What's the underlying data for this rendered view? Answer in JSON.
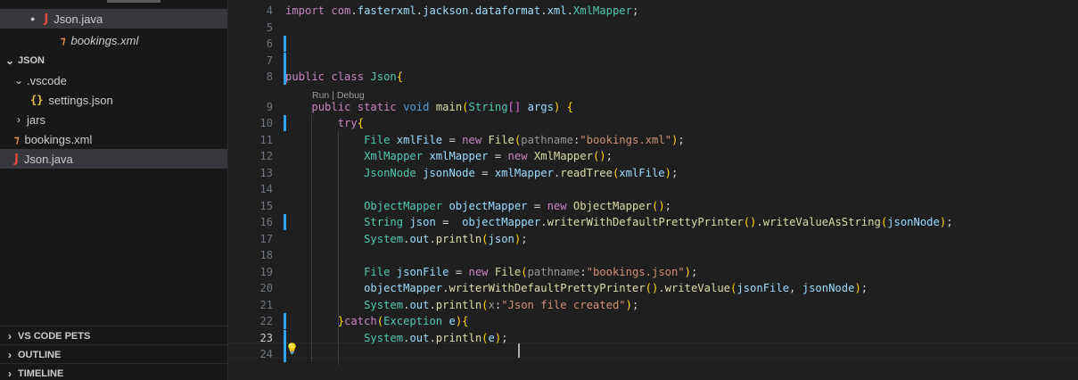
{
  "sidebar": {
    "open_editors": [
      {
        "name": "Json.java",
        "icon": "java-file-icon",
        "active": true,
        "modified": true
      },
      {
        "name": "bookings.xml",
        "icon": "xml-file-icon",
        "italic": true
      }
    ],
    "folder": {
      "title": "JSON",
      "items": [
        {
          "name": ".vscode",
          "type": "folder",
          "expanded": true
        },
        {
          "name": "settings.json",
          "type": "file",
          "icon": "json-file-icon"
        },
        {
          "name": "jars",
          "type": "folder",
          "expanded": false
        },
        {
          "name": "bookings.xml",
          "type": "file",
          "icon": "xml-file-icon"
        },
        {
          "name": "Json.java",
          "type": "file",
          "icon": "java-file-icon"
        }
      ]
    },
    "sections": [
      "VS CODE PETS",
      "OUTLINE",
      "TIMELINE"
    ]
  },
  "editor": {
    "current_line": 23,
    "codelens": "Run | Debug",
    "lines": [
      {
        "n": 4,
        "text": "import com.fasterxml.jackson.dataformat.xml.XmlMapper;"
      },
      {
        "n": 5,
        "text": ""
      },
      {
        "n": 6,
        "text": ""
      },
      {
        "n": 7,
        "text": ""
      },
      {
        "n": 8,
        "text": "public class Json{"
      },
      {
        "n": 9,
        "text": "    public static void main(String[] args) {"
      },
      {
        "n": 10,
        "text": "        try{"
      },
      {
        "n": 11,
        "text": "            File xmlFile = new File(pathname:\"bookings.xml\");"
      },
      {
        "n": 12,
        "text": "            XmlMapper xmlMapper = new XmlMapper();"
      },
      {
        "n": 13,
        "text": "            JsonNode jsonNode = xmlMapper.readTree(xmlFile);"
      },
      {
        "n": 14,
        "text": ""
      },
      {
        "n": 15,
        "text": "            ObjectMapper objectMapper = new ObjectMapper();"
      },
      {
        "n": 16,
        "text": "            String json =  objectMapper.writerWithDefaultPrettyPrinter().writeValueAsString(jsonNode);"
      },
      {
        "n": 17,
        "text": "            System.out.println(json);"
      },
      {
        "n": 18,
        "text": ""
      },
      {
        "n": 19,
        "text": "            File jsonFile = new File(pathname:\"bookings.json\");"
      },
      {
        "n": 20,
        "text": "            objectMapper.writerWithDefaultPrettyPrinter().writeValue(jsonFile, jsonNode);"
      },
      {
        "n": 21,
        "text": "            System.out.println(x:\"Json file created\");"
      },
      {
        "n": 22,
        "text": "        }catch(Exception e){"
      },
      {
        "n": 23,
        "text": "            System.out.println(e);"
      },
      {
        "n": 24,
        "text": ""
      }
    ],
    "colors": {
      "keyword": "#c586c0",
      "storage": "#569cd6",
      "type": "#4ec9b0",
      "function": "#dcdcaa",
      "variable": "#9cdcfe",
      "string": "#ce9178",
      "background": "#1f1f1f",
      "modified_gutter": "#2ea3f2"
    }
  }
}
